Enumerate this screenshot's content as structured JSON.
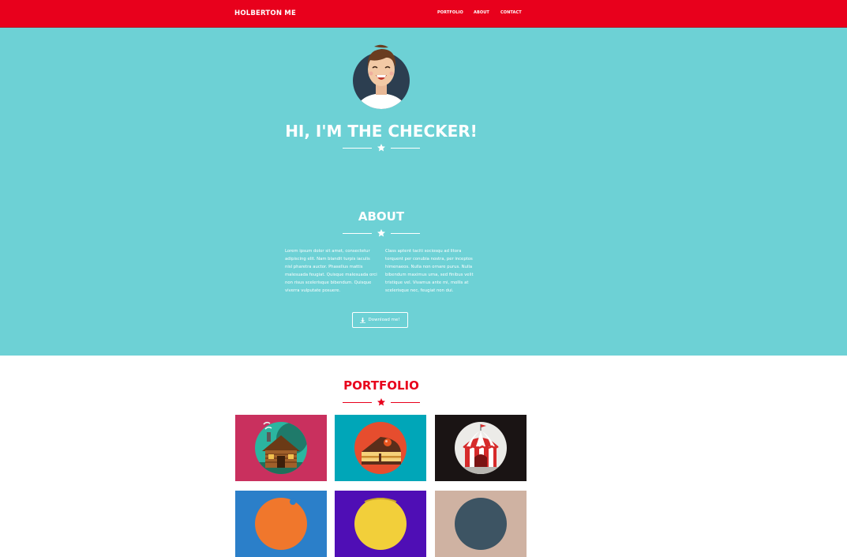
{
  "nav": {
    "brand": "HOLBERTON ME",
    "links": [
      "PORTFOLIO",
      "ABOUT",
      "CONTACT"
    ],
    "bg_color": "#e8001c"
  },
  "hero": {
    "title": "HI, I'M THE CHECKER!",
    "bg_color": "#6dd1d5"
  },
  "about": {
    "title": "ABOUT",
    "col1": "Lorem ipsum dolor sit amet, consectetur adipiscing elit. Nam blandit turpis iaculis nisl pharetra auctor. Phasellus mattis malesuada feugiat. Quisque malesuada orci non risus scelerisque bibendum. Quisque viverra vulputate posuere.",
    "col2": "Class aptent taciti sociosqu ad litora torquent per conubia nostra, per inceptos himenaeos. Nulla non ornare purus. Nulla bibendum maximus urna, sed finibus velit tristique vel. Vivamus ante mi, mollis at scelerisque nec, feugiat non dui.",
    "download_label": "Download me!"
  },
  "portfolio": {
    "title": "PORTFOLIO",
    "accent_color": "#e8001c",
    "tiles": [
      {
        "icon": "cabin-icon",
        "bg": "#c9305e"
      },
      {
        "icon": "cake-icon",
        "bg": "#00a6b8"
      },
      {
        "icon": "circus-tent-icon",
        "bg": "#1a1414"
      },
      {
        "icon": "game-controller-icon",
        "bg": "#2b7fc9"
      },
      {
        "icon": "safe-icon",
        "bg": "#4f0eb5"
      },
      {
        "icon": "submarine-icon",
        "bg": "#cfb2a2"
      }
    ]
  }
}
